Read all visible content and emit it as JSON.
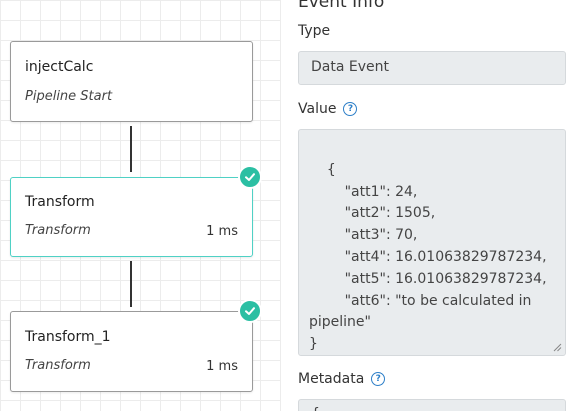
{
  "pipeline": {
    "nodes": [
      {
        "title": "injectCalc",
        "subtitle": "Pipeline Start",
        "time": "",
        "status": ""
      },
      {
        "title": "Transform",
        "subtitle": "Transform",
        "time": "1 ms",
        "status": "success"
      },
      {
        "title": "Transform_1",
        "subtitle": "Transform",
        "time": "1 ms",
        "status": "success"
      }
    ]
  },
  "event_info": {
    "heading": "Event Info",
    "type_label": "Type",
    "type_value": "Data Event",
    "value_label": "Value",
    "value_text": "{\n        \"att1\": 24,\n        \"att2\": 1505,\n        \"att3\": 70,\n        \"att4\": 16.01063829787234,\n        \"att5\": 16.01063829787234,\n        \"att6\": \"to be calculated in pipeline\"\n}",
    "metadata_label": "Metadata",
    "metadata_value": "{"
  },
  "colors": {
    "accent": "#2bbfa3",
    "selected_border": "#4fd1c5",
    "help_icon": "#2d7fc8"
  }
}
